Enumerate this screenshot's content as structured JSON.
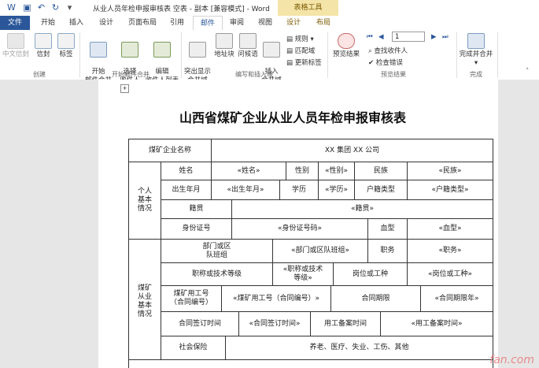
{
  "window": {
    "title": "从业人员年检申报审核表 空表 - 副本 [兼容模式] - Word",
    "context_group": "表格工具"
  },
  "tabs": [
    "文件",
    "开始",
    "插入",
    "设计",
    "页面布局",
    "引用",
    "邮件",
    "审阅",
    "视图",
    "设计",
    "布局"
  ],
  "ribbon": {
    "create": {
      "chinese_envelope": "中文信封",
      "envelope": "信封",
      "label": "标签",
      "group": "创建"
    },
    "start_merge": {
      "start": "开始\n邮件合并",
      "select": "选择\n收件人",
      "edit": "编辑\n收件人列表",
      "group": "开始邮件合并"
    },
    "write_insert": {
      "highlight": "突出显示\n合并域",
      "address": "地址块",
      "greeting": "问候语",
      "insert_field": "插入\n合并域",
      "rules": "规则",
      "match": "匹配域",
      "update": "更新标签",
      "group": "编写和插入域"
    },
    "preview": {
      "preview_btn": "预览结果",
      "record": "1",
      "find": "查找收件人",
      "check": "检查错误",
      "group": "预览结果"
    },
    "finish": {
      "finish_btn": "完成并合并",
      "group": "完成"
    }
  },
  "document": {
    "title": "山西省煤矿企业从业人员年检申报审核表",
    "rows": {
      "company_label": "煤矿企业名称",
      "company_value": "XX 集团 XX 公司",
      "section1": "个人\n基本\n情况",
      "name_label": "姓名",
      "name_value": "«姓名»",
      "gender_label": "性别",
      "gender_value": "«性别»",
      "ethnic_label": "民族",
      "ethnic_value": "«民族»",
      "birth_label": "出生年月",
      "birth_value": "«出生年月»",
      "edu_label": "学历",
      "edu_value": "«学历»",
      "hukou_label": "户籍类型",
      "hukou_value": "«户籍类型»",
      "native_label": "籍贯",
      "native_value": "«籍贯»",
      "id_label": "身份证号",
      "id_value": "«身份证号码»",
      "blood_label": "血型",
      "blood_value": "«血型»",
      "section2": "煤矿\n从业\n基本\n情况",
      "dept_label": "部门或区\n队班组",
      "dept_value": "«部门或区队班组»",
      "duty_label": "职务",
      "duty_value": "«职务»",
      "title_label": "职称或技术等级",
      "title_value": "«职称或技术\n等级»",
      "post_label": "岗位或工种",
      "post_value": "«岗位或工种»",
      "empno_label": "煤矿用工号\n（合同编号）",
      "empno_value": "«煤矿用工号（合同编号）»",
      "term_label": "合同期限",
      "term_value": "«合同期限年»",
      "sign_label": "合同签订时间",
      "sign_value": "«合同签订时间»",
      "file_label": "用工备案时间",
      "file_value": "«用工备案时间»",
      "ins_label": "社会保险",
      "ins_value": "养老、医疗、失业、工伤、其他"
    }
  },
  "watermark": "fan.com"
}
